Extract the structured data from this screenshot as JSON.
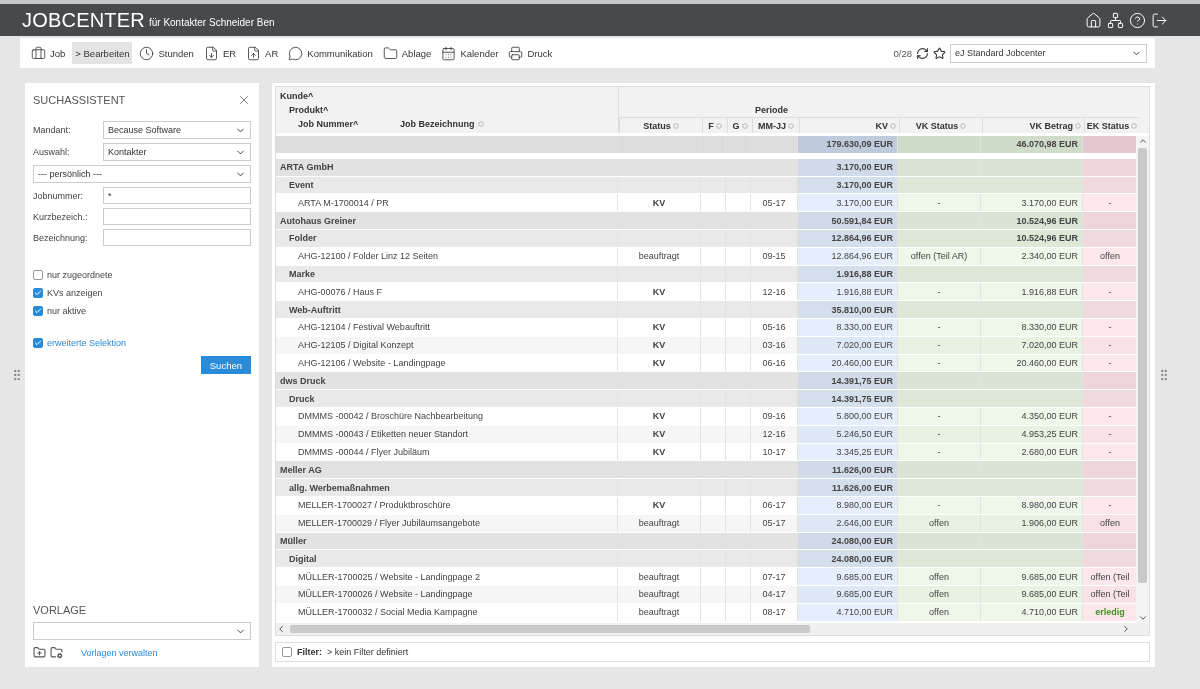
{
  "app": {
    "title": "JOBCENTER",
    "subtitle": "für Kontakter Schneider Ben"
  },
  "toolbar": {
    "items": [
      {
        "label": "Job",
        "selected": false
      },
      {
        "label": "Bearbeiten",
        "prefix": ">",
        "selected": true
      },
      {
        "label": "Stunden",
        "selected": false
      },
      {
        "label": "ER",
        "selected": false
      },
      {
        "label": "AR",
        "selected": false
      },
      {
        "label": "Kommunikation",
        "selected": false
      },
      {
        "label": "Ablage",
        "selected": false
      },
      {
        "label": "Kalender",
        "selected": false
      },
      {
        "label": "Druck",
        "selected": false
      }
    ],
    "counter": "0/28",
    "view_select": "eJ Standard Jobcenter"
  },
  "search_panel": {
    "title": "SUCHASSISTENT",
    "fields": [
      {
        "kind": "select",
        "label": "Mandant:",
        "value": "Because Software"
      },
      {
        "kind": "select",
        "label": "Auswahl:",
        "value": "Kontakter"
      },
      {
        "kind": "select",
        "value": "--- persönlich ---"
      },
      {
        "kind": "input",
        "label": "Jobnummer:",
        "value": "*"
      },
      {
        "kind": "input",
        "label": "Kurzbezeich.:"
      },
      {
        "kind": "input",
        "label": "Bezeichnung:"
      }
    ],
    "checkboxes": [
      {
        "label": "nur zugeordnete",
        "checked": false
      },
      {
        "label": "KVs anzeigen",
        "checked": true
      },
      {
        "label": "nur aktive",
        "checked": true
      }
    ],
    "extended": {
      "label": "erweiterte Selektion",
      "checked": true
    },
    "search_button": "Suchen",
    "template_title": "VORLAGE",
    "template_link": "Vorlagen verwalten"
  },
  "table": {
    "header_levels": [
      "Kunde^",
      "Produkt^",
      "Job Nummer^"
    ],
    "name_column": "Job Bezeichnung",
    "columns": [
      {
        "label": "Status"
      },
      {
        "label": "F"
      },
      {
        "label": "G"
      },
      {
        "label": "MM-JJ",
        "caption": "Periode"
      },
      {
        "label": "KV"
      },
      {
        "label": "VK Status"
      },
      {
        "label": "VK Betrag"
      },
      {
        "label": "EK Status"
      }
    ],
    "totals": {
      "kv": "179.630,09 EUR",
      "vk_betrag": "46.070,98 EUR"
    },
    "customers": [
      {
        "label": "ARTA GmbH",
        "kv": "3.170,00 EUR",
        "children": [
          {
            "label": "Event",
            "kv": "3.170,00 EUR",
            "children": [
              {
                "label": "ARTA M-1700014 / PR",
                "status": "KV",
                "status_emphasis": true,
                "period": "05-17",
                "kv": "3.170,00 EUR",
                "vk_status": "-",
                "vk_betrag": "3.170,00 EUR",
                "ek_status": "-"
              }
            ]
          }
        ]
      },
      {
        "label": "Autohaus Greiner",
        "kv": "50.591,84 EUR",
        "vk_betrag": "10.524,96 EUR",
        "children": [
          {
            "label": "Folder",
            "kv": "12.864,96 EUR",
            "vk_betrag": "10.524,96 EUR",
            "children": [
              {
                "label": "AHG-12100 / Folder Linz 12 Seiten",
                "status": "beauftragt",
                "status_emphasis": false,
                "period": "09-15",
                "kv": "12.864,96 EUR",
                "vk_status": "offen (Teil AR)",
                "vk_betrag": "2.340,00 EUR",
                "ek_status": "offen"
              }
            ]
          },
          {
            "label": "Marke",
            "kv": "1.916,88 EUR",
            "children": [
              {
                "label": "AHG-00076 / Haus F",
                "status": "KV",
                "status_emphasis": true,
                "period": "12-16",
                "kv": "1.916,88 EUR",
                "vk_status": "-",
                "vk_betrag": "1.916,88 EUR",
                "ek_status": "-"
              }
            ]
          },
          {
            "label": "Web-Auftritt",
            "kv": "35.810,00 EUR",
            "children": [
              {
                "label": "AHG-12104 / Festival Webauftritt",
                "status": "KV",
                "status_emphasis": true,
                "period": "05-16",
                "kv": "8.330,00 EUR",
                "vk_status": "-",
                "vk_betrag": "8.330,00 EUR",
                "ek_status": "-"
              },
              {
                "label": "AHG-12105 / Digital Konzept",
                "status": "KV",
                "status_emphasis": true,
                "period": "03-16",
                "kv": "7.020,00 EUR",
                "vk_status": "-",
                "vk_betrag": "7.020,00 EUR",
                "ek_status": "-"
              },
              {
                "label": "AHG-12106 / Website - Landingpage",
                "status": "KV",
                "status_emphasis": true,
                "period": "06-16",
                "kv": "20.460,00 EUR",
                "vk_status": "-",
                "vk_betrag": "20.460,00 EUR",
                "ek_status": "-"
              }
            ]
          }
        ]
      },
      {
        "label": "dws Druck",
        "kv": "14.391,75 EUR",
        "children": [
          {
            "label": "Druck",
            "kv": "14.391,75 EUR",
            "children": [
              {
                "label": "DMMMS -00042 / Broschüre Nachbearbeitung",
                "status": "KV",
                "status_emphasis": true,
                "period": "09-16",
                "kv": "5.800,00 EUR",
                "vk_status": "-",
                "vk_betrag": "4.350,00 EUR",
                "ek_status": "-"
              },
              {
                "label": "DMMMS -00043 / Etiketten neuer Standort",
                "status": "KV",
                "status_emphasis": true,
                "period": "12-16",
                "kv": "5.246,50 EUR",
                "vk_status": "-",
                "vk_betrag": "4.953,25 EUR",
                "ek_status": "-"
              },
              {
                "label": "DMMMS -00044 / Flyer Jubiläum",
                "status": "KV",
                "status_emphasis": true,
                "period": "10-17",
                "kv": "3.345,25 EUR",
                "vk_status": "-",
                "vk_betrag": "2.680,00 EUR",
                "ek_status": "-"
              }
            ]
          }
        ]
      },
      {
        "label": "Meller AG",
        "kv": "11.626,00 EUR",
        "children": [
          {
            "label": "allg. Werbemaßnahmen",
            "kv": "11.626,00 EUR",
            "children": [
              {
                "label": "MELLER-1700027 / Produktbroschüre",
                "status": "KV",
                "status_emphasis": true,
                "period": "06-17",
                "kv": "8.980,00 EUR",
                "vk_status": "-",
                "vk_betrag": "8.980,00 EUR",
                "ek_status": "-"
              },
              {
                "label": "MELLER-1700029 / Flyer Jubiläumsangebote",
                "status": "beauftragt",
                "status_emphasis": false,
                "period": "05-17",
                "kv": "2.646,00 EUR",
                "vk_status": "offen",
                "vk_betrag": "1.906,00 EUR",
                "ek_status": "offen"
              }
            ]
          }
        ]
      },
      {
        "label": "Müller",
        "kv": "24.080,00 EUR",
        "children": [
          {
            "label": "Digital",
            "kv": "24.080,00 EUR",
            "children": [
              {
                "label": "MÜLLER-1700025 / Website - Landingpage 2",
                "status": "beauftragt",
                "status_emphasis": false,
                "period": "07-17",
                "kv": "9.685,00 EUR",
                "vk_status": "offen",
                "vk_betrag": "9.685,00 EUR",
                "ek_status": "offen (Teil"
              },
              {
                "label": "MÜLLER-1700026 / Website - Landingpage",
                "status": "beauftragt",
                "status_emphasis": false,
                "period": "04-17",
                "kv": "9.685,00 EUR",
                "vk_status": "offen",
                "vk_betrag": "9.685,00 EUR",
                "ek_status": "offen (Teil"
              },
              {
                "label": "MÜLLER-1700032 / Social Media Kampagne",
                "status": "beauftragt",
                "status_emphasis": false,
                "period": "08-17",
                "kv": "4.710,00 EUR",
                "vk_status": "offen",
                "vk_betrag": "4.710,00 EUR",
                "ek_status": "erledig",
                "ek_done": true
              }
            ]
          }
        ]
      }
    ],
    "filter": {
      "label": "Filter:",
      "checked": false,
      "prefix": ">",
      "value": "kein Filter definiert"
    }
  }
}
